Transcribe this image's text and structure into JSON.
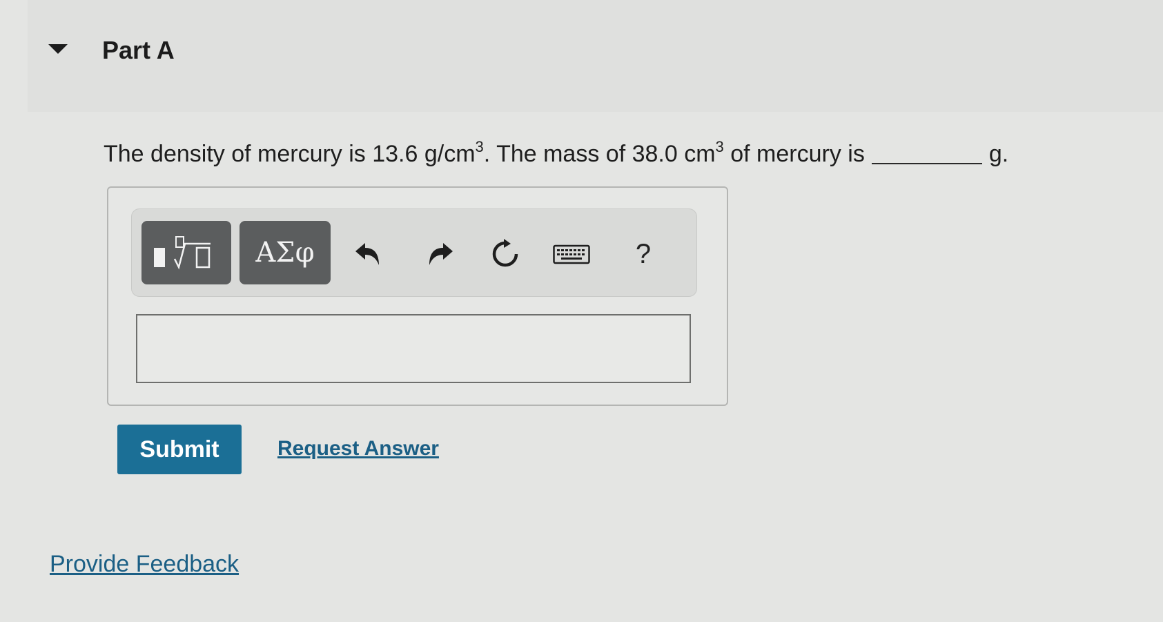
{
  "part": {
    "title": "Part A"
  },
  "question": {
    "t1": "The density of mercury is 13.6 g/cm",
    "sup1": "3",
    "t2": ". The mass of 38.0 cm",
    "sup2": "3",
    "t3": " of mercury is",
    "unit": "g."
  },
  "toolbar": {
    "greek_label": "ΑΣφ",
    "help_label": "?",
    "icons": [
      "templates-icon",
      "greek-symbols-icon",
      "undo-icon",
      "redo-icon",
      "reset-icon",
      "keyboard-icon",
      "help-icon"
    ]
  },
  "answer": {
    "value": ""
  },
  "actions": {
    "submit_label": "Submit",
    "request_label": "Request Answer"
  },
  "footer": {
    "feedback_label": "Provide Feedback"
  },
  "colors": {
    "accent": "#1b6f96",
    "link": "#1b5f85",
    "toolbar_button": "#5b5d5e"
  }
}
